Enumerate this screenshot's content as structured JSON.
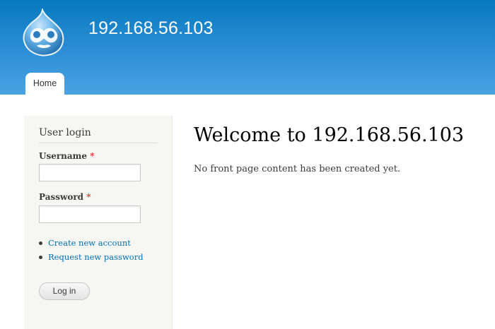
{
  "header": {
    "site_name": "192.168.56.103",
    "logo_icon": "drupal-drop-icon",
    "gradient_top": "#0779bf",
    "gradient_bottom": "#4aa3e2"
  },
  "nav": {
    "tabs": [
      {
        "label": "Home",
        "active": true
      }
    ]
  },
  "sidebar": {
    "block_title": "User login",
    "username_label": "Username",
    "password_label": "Password",
    "required_marker": "*",
    "username_value": "",
    "password_value": "",
    "links": [
      {
        "label": "Create new account"
      },
      {
        "label": "Request new password"
      }
    ],
    "submit_label": "Log in"
  },
  "main": {
    "title": "Welcome to 192.168.56.103",
    "message": "No front page content has been created yet."
  },
  "colors": {
    "link": "#0071b3",
    "required": "#ee3333",
    "sidebar_bg": "#f6f6f2"
  }
}
